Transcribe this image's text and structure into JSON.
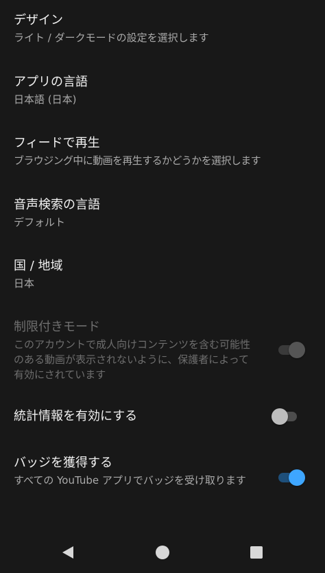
{
  "settings": {
    "design": {
      "title": "デザイン",
      "subtitle": "ライト / ダークモードの設定を選択します"
    },
    "app_language": {
      "title": "アプリの言語",
      "subtitle": "日本語 (日本)"
    },
    "feed_playback": {
      "title": "フィードで再生",
      "subtitle": "ブラウジング中に動画を再生するかどうかを選択します"
    },
    "voice_search_language": {
      "title": "音声検索の言語",
      "subtitle": "デフォルト"
    },
    "region": {
      "title": "国 / 地域",
      "subtitle": "日本"
    },
    "restricted_mode": {
      "title": "制限付きモード",
      "subtitle": "このアカウントで成人向けコンテンツを含む可能性のある動画が表示されないように、保護者によって有効にされています",
      "toggle": "on",
      "enabled": false
    },
    "stats": {
      "title": "統計情報を有効にする",
      "toggle": "off"
    },
    "badges": {
      "title": "バッジを獲得する",
      "subtitle": "すべての YouTube アプリでバッジを受け取ります",
      "toggle": "on"
    }
  },
  "nav": {
    "back_icon": "back-triangle-icon",
    "home_icon": "home-circle-icon",
    "recents_icon": "recents-square-icon"
  },
  "colors": {
    "background": "#181818",
    "accent": "#3ea6ff"
  }
}
